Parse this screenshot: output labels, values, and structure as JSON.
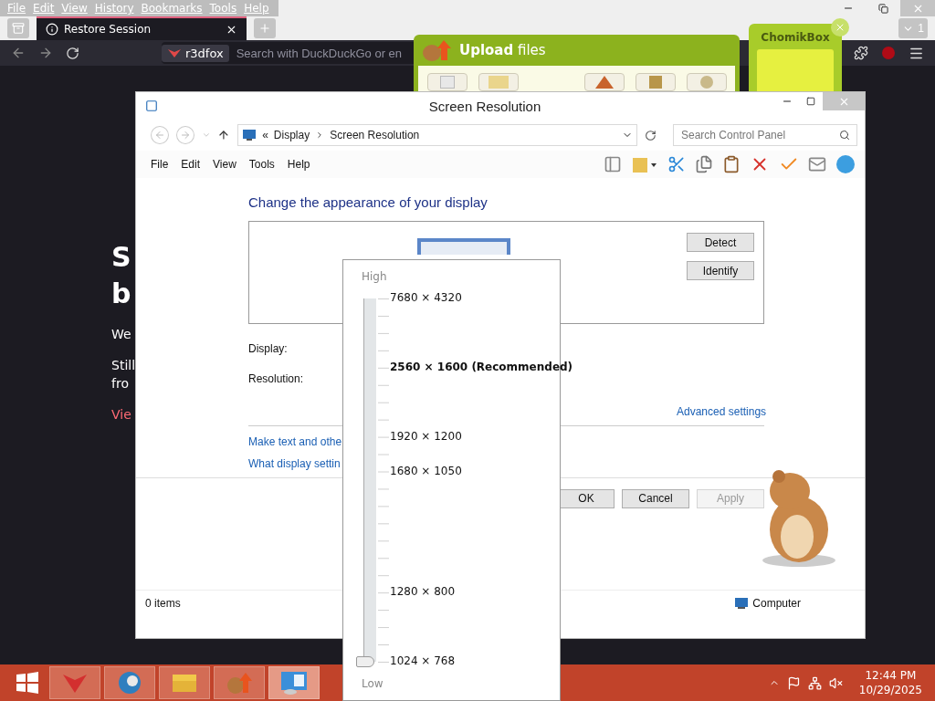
{
  "browser": {
    "menu": [
      "File",
      "Edit",
      "View",
      "History",
      "Bookmarks",
      "Tools",
      "Help"
    ],
    "tabs": [
      {
        "label": "Restore Session",
        "selected": true
      }
    ],
    "tab_count": "1",
    "identity": "r3dfox",
    "search": {
      "placeholder": "Search with DuckDuckGo or en"
    },
    "page": {
      "heading": [
        "S",
        "b"
      ],
      "paragraphs": [
        "We",
        "Still",
        "fro"
      ],
      "link": "Vie"
    }
  },
  "upload": {
    "title": "**Upload** files",
    "tiles": [
      {
        "kind": "page"
      },
      {
        "kind": "folder"
      },
      {
        "kind": "home"
      },
      {
        "kind": "box"
      },
      {
        "kind": "tools"
      }
    ]
  },
  "chomikbox": {
    "title": "ChomikBox"
  },
  "control_panel": {
    "title": "Screen Resolution",
    "overflow": "«",
    "breadcrumb": [
      "Display",
      "Screen Resolution"
    ],
    "search": {
      "placeholder": "Search Control Panel"
    },
    "menu": [
      "File",
      "Edit",
      "View",
      "Tools",
      "Help"
    ],
    "heading": "Change the appearance of your display",
    "side_buttons": [
      "Detect",
      "Identify"
    ],
    "fields": [
      "Display:",
      "Resolution:"
    ],
    "advanced": "Advanced settings",
    "links": [
      "Make text and othe",
      "What display settin"
    ],
    "actions": [
      {
        "label": "OK",
        "disabled": false
      },
      {
        "label": "Cancel",
        "disabled": false
      },
      {
        "label": "Apply",
        "disabled": true
      }
    ],
    "status": {
      "items": "0 items",
      "location": "Computer"
    }
  },
  "resolution_dropdown": {
    "high": "High",
    "low": "Low",
    "level": 0,
    "options": [
      {
        "label": "7680 × 4320",
        "recommended": false
      },
      {
        "label": "2560 × 1600 (Recommended)",
        "recommended": true
      },
      {
        "label": "1920 × 1200",
        "recommended": false
      },
      {
        "label": "1680 × 1050",
        "recommended": false
      },
      {
        "label": "1280 × 800",
        "recommended": false
      },
      {
        "label": "1024 × 768",
        "recommended": false
      }
    ]
  },
  "taskbar": {
    "apps": [
      {
        "kind": "fox",
        "selected": false
      },
      {
        "kind": "globe",
        "selected": false
      },
      {
        "kind": "folder",
        "selected": false
      },
      {
        "kind": "upload",
        "selected": false
      },
      {
        "kind": "panel",
        "selected": true
      }
    ],
    "time": "12:44 PM",
    "date": "10/29/2025"
  }
}
